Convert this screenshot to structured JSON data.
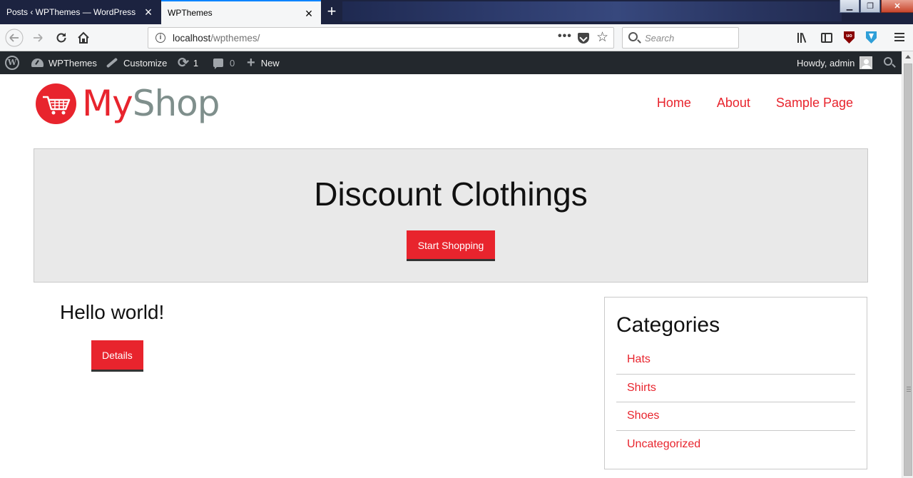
{
  "browser": {
    "tabs": [
      {
        "title": "Posts ‹ WPThemes — WordPress",
        "active": false
      },
      {
        "title": "WPThemes",
        "active": true
      }
    ],
    "url_host": "localhost",
    "url_path": "/wpthemes/",
    "search_placeholder": "Search",
    "icons": [
      "back-icon",
      "forward-icon",
      "reload-icon",
      "home-icon",
      "info-icon",
      "more-icon",
      "pocket-icon",
      "bookmark-star-icon",
      "library-icon",
      "sidebar-icon",
      "ublock-icon",
      "shield-icon",
      "menu-icon"
    ]
  },
  "adminbar": {
    "site_name": "WPThemes",
    "customize": "Customize",
    "updates_count": "1",
    "comments_count": "0",
    "new_label": "New",
    "howdy": "Howdy, admin"
  },
  "site": {
    "logo_part1": "My",
    "logo_part2": "Shop",
    "nav": [
      "Home",
      "About",
      "Sample Page"
    ],
    "accent_color": "#e8242d"
  },
  "hero": {
    "title": "Discount Clothings",
    "button": "Start Shopping"
  },
  "post": {
    "title": "Hello world!",
    "button": "Details"
  },
  "sidebar": {
    "widget_title": "Categories",
    "categories": [
      "Hats",
      "Shirts",
      "Shoes",
      "Uncategorized"
    ]
  }
}
